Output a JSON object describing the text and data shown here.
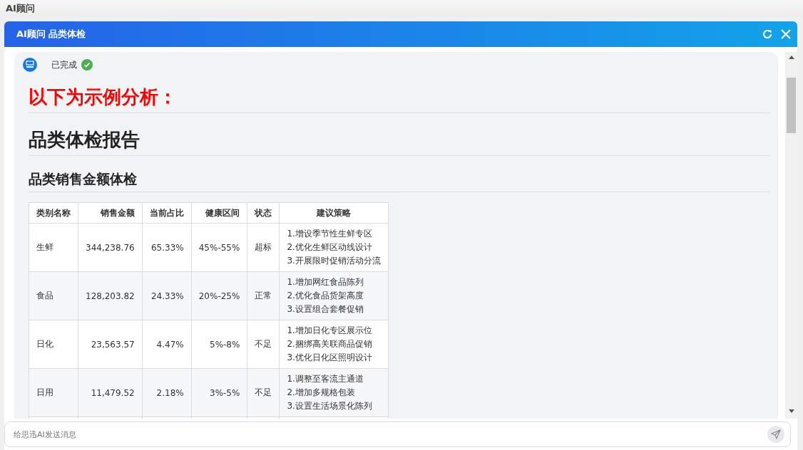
{
  "app_title": "AI顾问",
  "dialog": {
    "title": "AI顾问 品类体检"
  },
  "message": {
    "status": "已完成",
    "done": true,
    "notice": "以下为示例分析：",
    "heading": "品类体检报告",
    "subheading": "品类销售金额体检",
    "table": {
      "columns": [
        "类别名称",
        "销售金额",
        "当前占比",
        "健康区间",
        "状态",
        "建议策略"
      ],
      "rows": [
        {
          "cells": [
            "生鲜",
            "344,238.76",
            "65.33%",
            "45%-55%",
            "超标"
          ],
          "strategy": [
            "1.增设季节性生鲜专区",
            "2.优化生鲜区动线设计",
            "3.开展限时促销活动分流"
          ]
        },
        {
          "cells": [
            "食品",
            "128,203.82",
            "24.33%",
            "20%-25%",
            "正常"
          ],
          "strategy": [
            "1.增加网红食品陈列",
            "2.优化食品货架高度",
            "3.设置组合套餐促销"
          ]
        },
        {
          "cells": [
            "日化",
            "23,563.57",
            "4.47%",
            "5%-8%",
            "不足"
          ],
          "strategy": [
            "1.增加日化专区展示位",
            "2.捆绑高关联商品促销",
            "3.优化日化区照明设计"
          ]
        },
        {
          "cells": [
            "日用",
            "11,479.52",
            "2.18%",
            "3%-5%",
            "不足"
          ],
          "strategy": [
            "1.调整至客流主通道",
            "2.增加多规格包装",
            "3.设置生活场景化陈列"
          ]
        }
      ]
    }
  },
  "composer": {
    "placeholder": "给思迅AI发送消息"
  }
}
